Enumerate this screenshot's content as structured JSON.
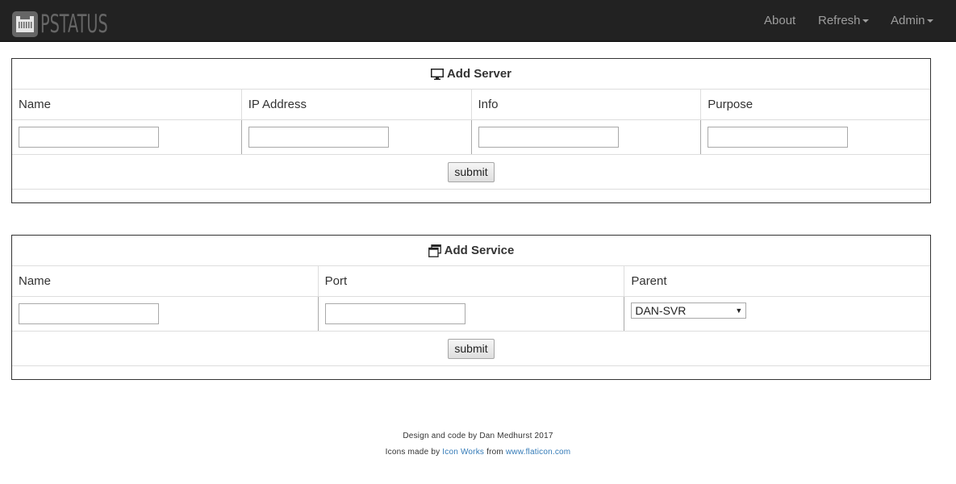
{
  "navbar": {
    "brand_text": "PSTATUS",
    "items": [
      {
        "label": "About",
        "dropdown": false
      },
      {
        "label": "Refresh",
        "dropdown": true
      },
      {
        "label": "Admin",
        "dropdown": true
      }
    ]
  },
  "add_server": {
    "title": "Add Server",
    "icon": "monitor-icon",
    "columns": [
      "Name",
      "IP Address",
      "Info",
      "Purpose"
    ],
    "values": [
      "",
      "",
      "",
      ""
    ],
    "submit_label": "submit"
  },
  "add_service": {
    "title": "Add Service",
    "icon": "windows-icon",
    "columns": [
      "Name",
      "Port",
      "Parent"
    ],
    "values": [
      "",
      ""
    ],
    "parent_selected": "DAN-SVR",
    "submit_label": "submit"
  },
  "footer": {
    "credit": "Design and code by Dan Medhurst 2017",
    "icons_prefix": "Icons made by",
    "icons_author": "Icon Works",
    "icons_middle": "from",
    "icons_site": "www.flaticon.com"
  },
  "colors": {
    "navbar_bg": "#222222",
    "nav_text": "#9d9d9d",
    "link": "#337ab7",
    "border": "#333333"
  }
}
